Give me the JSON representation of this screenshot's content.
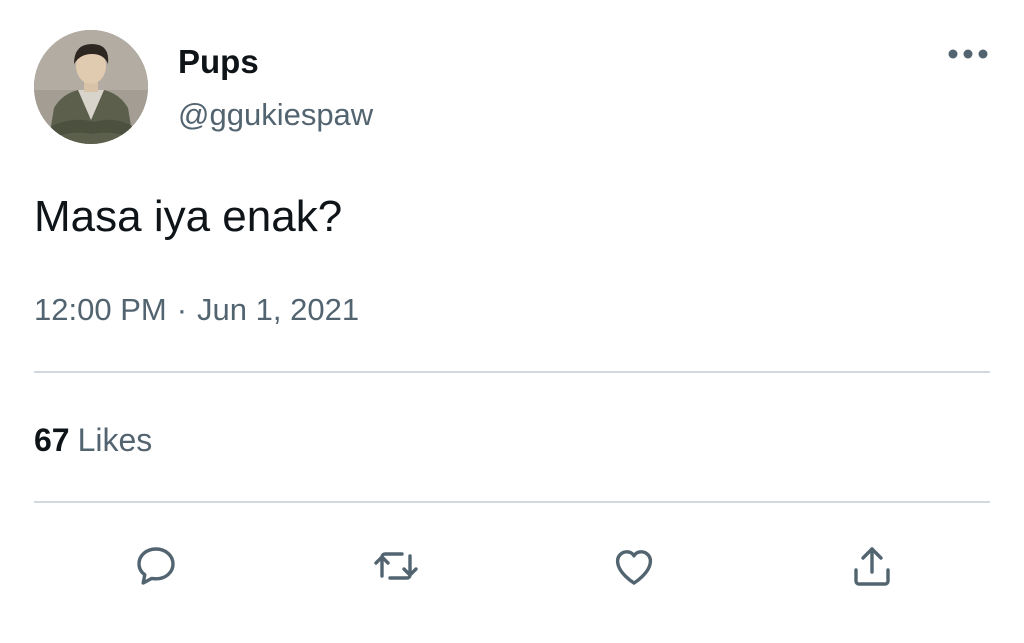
{
  "author": {
    "display_name": "Pups",
    "handle": "@ggukiespaw",
    "avatar_icon": "profile-photo"
  },
  "tweet": {
    "text": "Masa iya enak?",
    "time": "12:00 PM",
    "separator": "·",
    "date": "Jun 1, 2021"
  },
  "stats": {
    "likes_count": "67",
    "likes_label": "Likes"
  },
  "actions": {
    "reply_icon": "speech-bubble-icon",
    "retweet_icon": "retweet-arrows-icon",
    "like_icon": "heart-icon",
    "share_icon": "share-upload-icon",
    "more_icon": "ellipsis-icon"
  },
  "colors": {
    "text_primary": "#0f1419",
    "text_secondary": "#536471",
    "divider": "#cfd9de",
    "background": "#ffffff"
  }
}
